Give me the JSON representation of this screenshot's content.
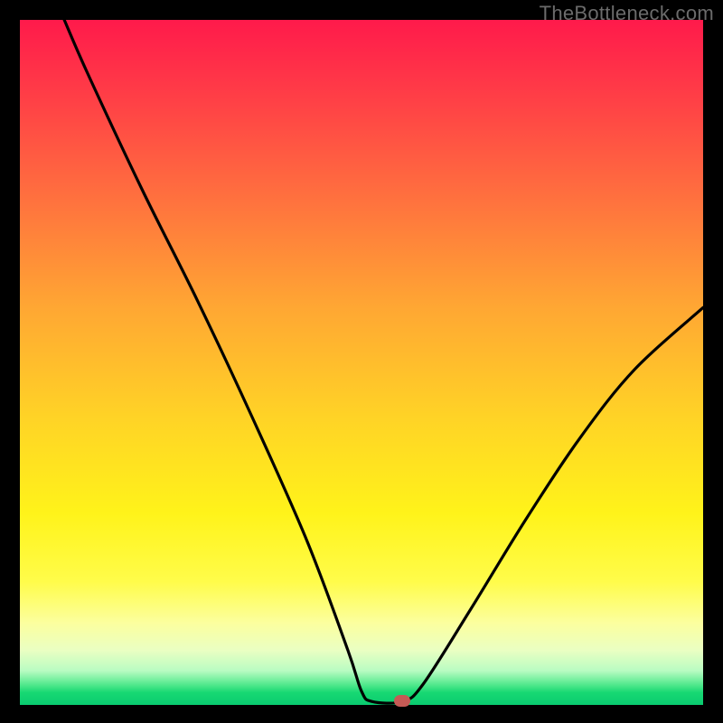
{
  "watermark": "TheBottleneck.com",
  "colors": {
    "frame": "#000000",
    "curve": "#000000",
    "marker": "#c55a55"
  },
  "chart_data": {
    "type": "line",
    "title": "",
    "xlabel": "",
    "ylabel": "",
    "xlim": [
      0,
      100
    ],
    "ylim": [
      0,
      100
    ],
    "grid": false,
    "curve_control_points": [
      {
        "x": 6.5,
        "y": 100
      },
      {
        "x": 10,
        "y": 92
      },
      {
        "x": 18,
        "y": 75
      },
      {
        "x": 26,
        "y": 59
      },
      {
        "x": 34,
        "y": 42
      },
      {
        "x": 42,
        "y": 24
      },
      {
        "x": 48,
        "y": 8
      },
      {
        "x": 50,
        "y": 2
      },
      {
        "x": 51.5,
        "y": 0.5
      },
      {
        "x": 56,
        "y": 0.5
      },
      {
        "x": 59,
        "y": 3
      },
      {
        "x": 66,
        "y": 14
      },
      {
        "x": 74,
        "y": 27
      },
      {
        "x": 82,
        "y": 39
      },
      {
        "x": 90,
        "y": 49
      },
      {
        "x": 100,
        "y": 58
      }
    ],
    "marker": {
      "x": 56,
      "y": 0.5
    }
  }
}
